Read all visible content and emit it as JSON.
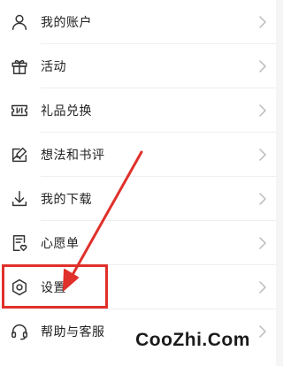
{
  "menu": {
    "items": [
      {
        "label": "我的账户",
        "icon": "user-icon"
      },
      {
        "label": "活动",
        "icon": "gift-icon"
      },
      {
        "label": "礼品兑换",
        "icon": "ticket-icon"
      },
      {
        "label": "想法和书评",
        "icon": "edit-note-icon"
      },
      {
        "label": "我的下载",
        "icon": "download-icon"
      },
      {
        "label": "心愿单",
        "icon": "wishlist-icon"
      },
      {
        "label": "设置",
        "icon": "gear-icon"
      },
      {
        "label": "帮助与客服",
        "icon": "headset-icon"
      }
    ]
  },
  "annotation": {
    "highlight_color": "#e0302a",
    "highlighted_item": "设置"
  },
  "watermark": {
    "text": "CooZhi.Com"
  },
  "colors": {
    "text": "#222222",
    "icon": "#333333",
    "chevron": "#bbbbbb",
    "divider": "#eeeeee"
  }
}
